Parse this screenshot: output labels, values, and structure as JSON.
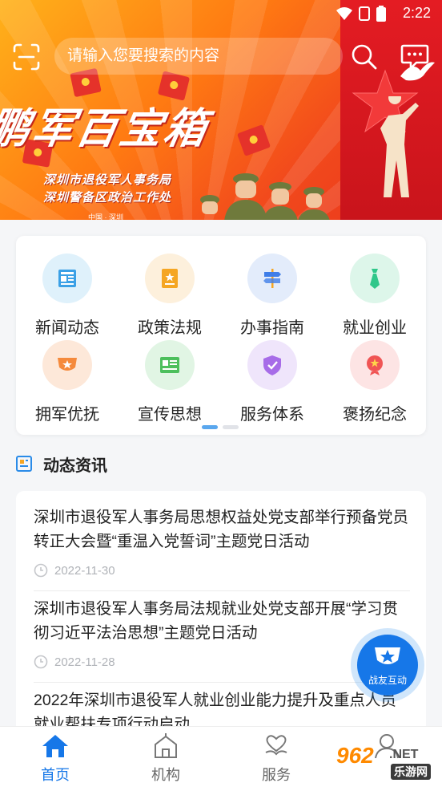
{
  "status_bar": {
    "time": "2:22"
  },
  "search": {
    "placeholder": "请输入您要搜索的内容"
  },
  "banner": {
    "title": "鹏军百宝箱",
    "line1": "深圳市退役军人事务局",
    "line2": "深圳警备区政治工作处",
    "small": "中国 · 深圳"
  },
  "categories": [
    {
      "label": "新闻动态",
      "icon": "newspaper-icon",
      "bg": "#dff1fb",
      "fg": "#3aa0e6"
    },
    {
      "label": "政策法规",
      "icon": "policy-book-icon",
      "bg": "#fdf0dc",
      "fg": "#f5a623"
    },
    {
      "label": "办事指南",
      "icon": "signpost-icon",
      "bg": "#e3ecfb",
      "fg": "#3f7ee8"
    },
    {
      "label": "就业创业",
      "icon": "tie-icon",
      "bg": "#ddf6ea",
      "fg": "#2fc78a"
    },
    {
      "label": "拥军优抚",
      "icon": "army-badge-icon",
      "bg": "#fde8d9",
      "fg": "#f58a3c"
    },
    {
      "label": "宣传思想",
      "icon": "party-board-icon",
      "bg": "#e1f5e4",
      "fg": "#4cbf5c"
    },
    {
      "label": "服务体系",
      "icon": "shield-check-icon",
      "bg": "#efe5fb",
      "fg": "#a76ce8"
    },
    {
      "label": "褒扬纪念",
      "icon": "wreath-icon",
      "bg": "#fde4e4",
      "fg": "#f05454"
    }
  ],
  "section": {
    "title": "动态资讯"
  },
  "news": [
    {
      "title": "深圳市退役军人事务局思想权益处党支部举行预备党员转正大会暨“重温入党誓词”主题党日活动",
      "date": "2022-11-30"
    },
    {
      "title": "深圳市退役军人事务局法规就业处党支部开展“学习贯彻习近平法治思想”主题党日活动",
      "date": "2022-11-28"
    },
    {
      "title": "2022年深圳市退役军人就业创业能力提升及重点人员就业帮扶专项行动启动",
      "date": ""
    }
  ],
  "float_button": {
    "label": "战友互动"
  },
  "bottom_nav": [
    {
      "label": "首页",
      "icon": "home-icon",
      "active": true
    },
    {
      "label": "机构",
      "icon": "building-icon",
      "active": false
    },
    {
      "label": "服务",
      "icon": "heart-hand-icon",
      "active": false
    },
    {
      "label": "我的",
      "icon": "user-icon",
      "active": false
    }
  ],
  "watermark": {
    "brand": "962",
    "net": ".NET",
    "cn": "乐游网"
  },
  "colors": {
    "accent": "#1677e8",
    "banner_orange": "#ff7a12",
    "banner_red": "#e41c23"
  }
}
